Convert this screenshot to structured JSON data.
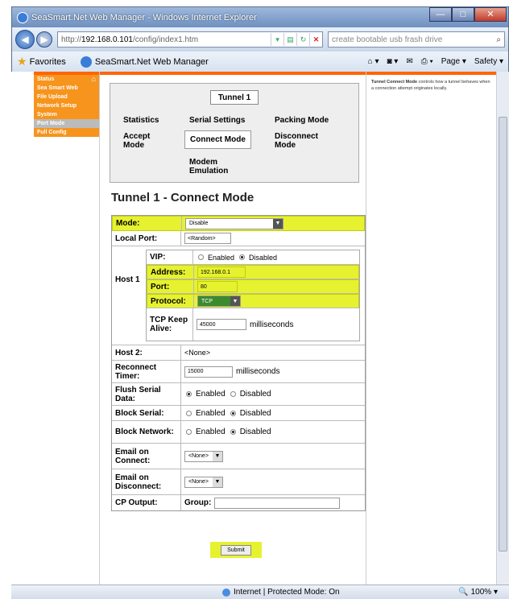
{
  "window": {
    "title": "SeaSmart.Net Web Manager - Windows Internet Explorer"
  },
  "browser": {
    "address_prefix": "http://",
    "address_host": "192.168.0.101",
    "address_path": "/config/index1.htm",
    "search_placeholder": "create bootable usb frash drive",
    "favorites_label": "Favorites",
    "tab_title": "SeaSmart.Net Web Manager",
    "page_menu": "Page ▾",
    "safety_menu": "Safety ▾"
  },
  "sidenav": {
    "items": [
      {
        "label": "Status"
      },
      {
        "label": "Sea Smart Web"
      },
      {
        "label": "File Upload"
      },
      {
        "label": "Network Setup"
      },
      {
        "label": "System"
      },
      {
        "label": "Port Mode"
      },
      {
        "label": "Full Config"
      }
    ]
  },
  "help_text": {
    "bold": "Tunnel Connect Mode",
    "rest": " controls how a tunnel behaves when a connection attempt originates locally."
  },
  "tunnel_tabs": {
    "button": "Tunnel 1",
    "statistics": "Statistics",
    "serial_settings": "Serial Settings",
    "packing_mode": "Packing Mode",
    "accept_mode": "Accept Mode",
    "connect_mode": "Connect Mode",
    "disconnect_mode": "Disconnect Mode",
    "modem_emulation": "Modem Emulation"
  },
  "heading": "Tunnel 1 - Connect Mode",
  "form": {
    "mode_label": "Mode:",
    "mode_value": "Disable",
    "local_port_label": "Local Port:",
    "local_port_value": "<Random>",
    "host1_label": "Host 1",
    "vip_label": "VIP:",
    "enabled": "Enabled",
    "disabled": "Disabled",
    "address_label": "Address:",
    "address_value": "192.168.0.1",
    "port_label": "Port:",
    "port_value": "80",
    "protocol_label": "Protocol:",
    "protocol_value": "TCP",
    "keepalive_label": "TCP Keep Alive:",
    "keepalive_value": "45000",
    "milliseconds": "milliseconds",
    "host2_label": "Host 2:",
    "host2_value": "<None>",
    "reconnect_label": "Reconnect Timer:",
    "reconnect_value": "15000",
    "flush_label": "Flush Serial Data:",
    "block_serial_label": "Block Serial:",
    "block_network_label": "Block Network:",
    "email_connect_label": "Email on Connect:",
    "email_connect_value": "<None>",
    "email_disconnect_label": "Email on Disconnect:",
    "email_disconnect_value": "<None>",
    "cp_output_label": "CP Output:",
    "group_label": "Group:",
    "submit": "Submit"
  },
  "status": {
    "zone": "Internet | Protected Mode: On",
    "zoom": "100%"
  }
}
